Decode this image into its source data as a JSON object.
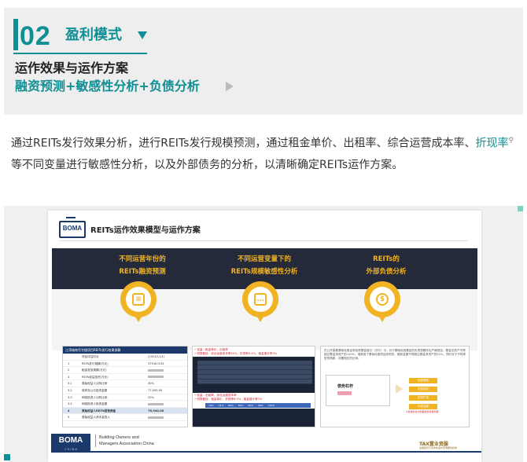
{
  "section": {
    "number": "02",
    "title": "盈利模式",
    "subtitle_main": "运作效果与运作方案",
    "subtitle_accent": "融资预测+敏感性分析+负债分析"
  },
  "description": {
    "text_before": "通过REITs发行效果分析，进行REITs发行规模预测，通过租金单价、出租率、综合运营成本率、",
    "link": "折现率",
    "text_after": "等不同变量进行敏感性分析，以及外部债务的分析，以清晰确定REITs运作方案。"
  },
  "slide": {
    "logo": "BOMA",
    "title": "REITs运作效果模型与运作方案",
    "pillars": [
      {
        "line1": "不同运营年份的",
        "line2": "REITs融资预测",
        "icon": "document-icon"
      },
      {
        "line1": "不同运营变量下的",
        "line2": "REITs规模敏感性分析",
        "icon": "chat-icon"
      },
      {
        "line1": "REITs的",
        "line2": "外部负债分析",
        "icon": "dollar-icon"
      }
    ],
    "table": {
      "header": "江湾城南写字楼项目REITs发行效果测算",
      "rows": [
        {
          "c0": "",
          "c1": "项目评估时点",
          "c2": "(2023/11/1)",
          "hl": false
        },
        {
          "c0": "1",
          "c1": "REITs发行规模(万元)",
          "c2": "379,813.54",
          "hl": false
        },
        {
          "c0": "2",
          "c1": "租金发放规模(万元)",
          "c2": "",
          "hl": false
        },
        {
          "c0": "3",
          "c1": "REITs权益投资(万元)",
          "c2": "",
          "hl": false
        },
        {
          "c0": "3.1",
          "c1": "原始权益人认购比例",
          "c2": "30%",
          "hl": false
        },
        {
          "c0": "3.2",
          "c1": "政府及公众投资金额",
          "c2": "77,000.00",
          "hl": false
        },
        {
          "c0": "3.3",
          "c1": "网络投资人认购比例",
          "c2": "20%",
          "hl": false
        },
        {
          "c0": "3.4",
          "c1": "网络投资人投资金额",
          "c2": "",
          "hl": false
        },
        {
          "c0": "4",
          "c1": "原始权益人REITs回笼资金",
          "c2": "76,940.00",
          "hl": true
        },
        {
          "c0": "5",
          "c1": "原始权益人资本金投入",
          "c2": "",
          "hl": false
        }
      ]
    },
    "sensitivity": {
      "note1": "• 变量：租金单价，出租率",
      "note2": "• 测算假设：综合运营成本率40%，折现率6.5%，租金增长率3%",
      "note3": "• 变量：出租率，综合运营成本率",
      "note4": "• 测算假设：租金单价，折现率6.5%，租金增长率3%",
      "rate_row1": "70% 75% 80% 85% 90% 95% 100%",
      "rate_row2": "20% 25% 30% 35% 40% 45% 50%"
    },
    "debt": {
      "text": "在公开募集基础设施证券投资基金指引（试行）中，对于基础设施基金的负债规模作出严格规定，基金总资产不得超过基金净资产的140%，借款用于基础设施项目收购的，借款金额不得超过基金净资产的20%，同时对于不同类型的借款，设置相应的比例。",
      "box_label": "债务杠杆",
      "buttons": [
        "经营借款",
        "债务偿还",
        "债务扩张",
        "负债监管"
      ],
      "note": "※具体负债比例需结合项目测算"
    },
    "footer": {
      "logo": "BOMA",
      "logo_sub": "C H I N A",
      "line1": "Building Owners and",
      "line2": "Managers Association China",
      "partner": "TAX置业资服",
      "partner_sub": "全程顾问与资本化运作咨询服务机构"
    }
  },
  "colors": {
    "accent": "#0f8f93",
    "gold": "#f0b323",
    "navy": "#1b3a6b",
    "dark_band": "#252a3a"
  }
}
